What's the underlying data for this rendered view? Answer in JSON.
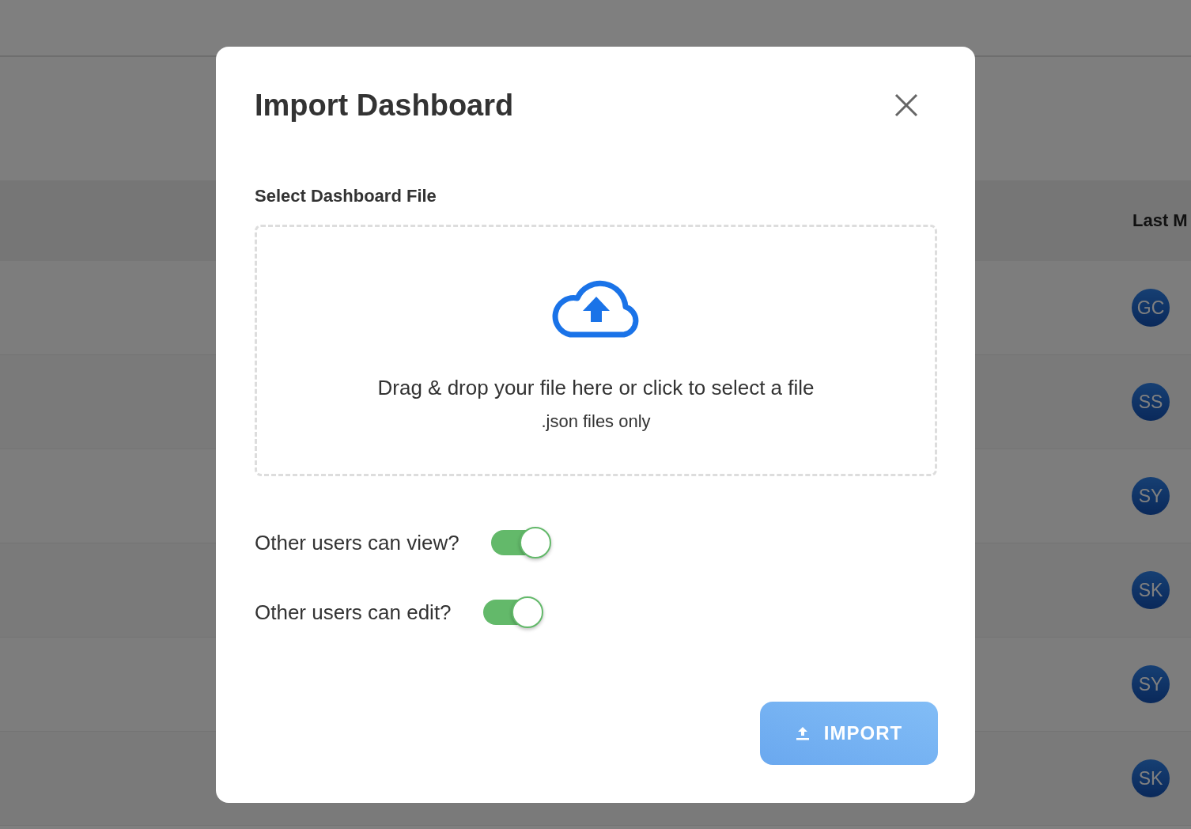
{
  "background": {
    "column_header": "Last M",
    "rows": [
      {
        "initials": "GC"
      },
      {
        "initials": "SS"
      },
      {
        "initials": "SY"
      },
      {
        "initials": "SK"
      },
      {
        "initials": "SY"
      },
      {
        "initials": "SK"
      }
    ]
  },
  "dialog": {
    "title": "Import Dashboard",
    "file_label": "Select Dashboard File",
    "dropzone": {
      "instruction": "Drag & drop your file here or click to select a file",
      "hint": ".json files only"
    },
    "toggles": [
      {
        "label": "Other users can view?",
        "on": true
      },
      {
        "label": "Other users can edit?",
        "on": true
      }
    ],
    "import_button": "IMPORT"
  }
}
